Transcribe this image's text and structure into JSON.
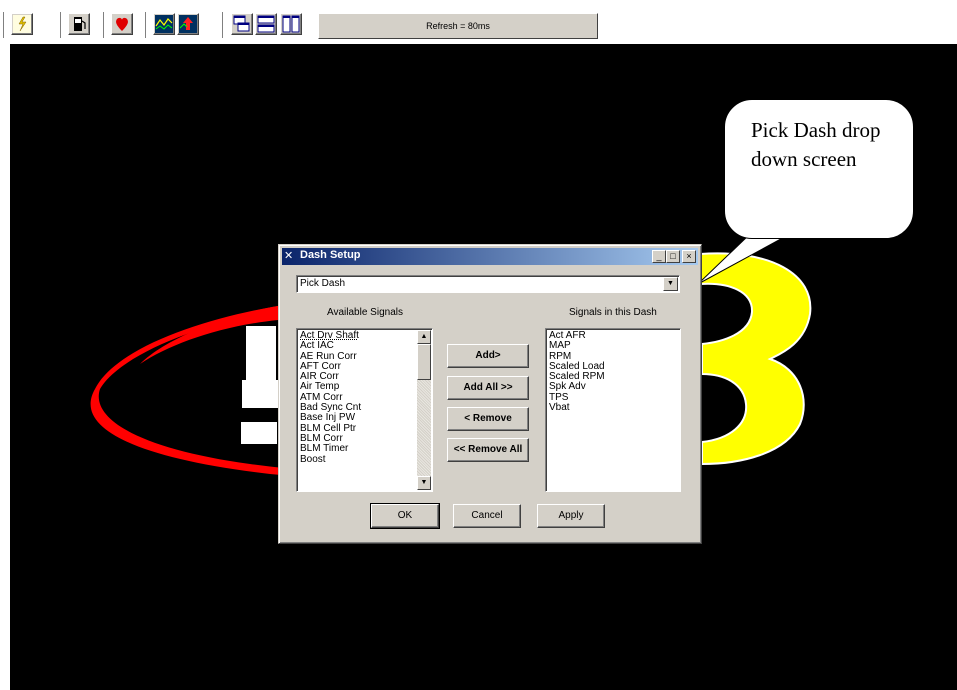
{
  "toolbar": {
    "refresh_label": "Refresh = 80ms",
    "buttons": [
      "lightning-icon",
      "fuel-pump-icon",
      "red-marker-icon",
      "chart-icon",
      "record-arrow-icon",
      "cascade-windows-icon",
      "tile-horizontal-icon",
      "tile-vertical-icon"
    ]
  },
  "callout": {
    "text": "Pick Dash drop down screen"
  },
  "dialog": {
    "title": "Dash Setup",
    "caption_buttons": {
      "minimize": "_",
      "maximize": "□",
      "close": "×"
    },
    "combo": {
      "value": "Pick Dash",
      "arrow": "▼"
    },
    "available_label": "Available Signals",
    "dash_label": "Signals in this Dash",
    "available_signals": [
      "Act Drv Shaft",
      "Act IAC",
      "AE Run Corr",
      "AFT Corr",
      "AIR Corr",
      "Air Temp",
      "ATM Corr",
      "Bad Sync Cnt",
      "Base Inj PW",
      "BLM Cell Ptr",
      "BLM Corr",
      "BLM Timer",
      "Boost"
    ],
    "dash_signals": [
      "Act AFR",
      "MAP",
      "RPM",
      "Scaled Load",
      "Scaled RPM",
      "Spk Adv",
      "TPS",
      "Vbat"
    ],
    "scroll_up": "▲",
    "scroll_down": "▼",
    "buttons": {
      "add": "Add>",
      "add_all": "Add All >>",
      "remove": "< Remove",
      "remove_all": "<< Remove All",
      "ok": "OK",
      "cancel": "Cancel",
      "apply": "Apply"
    }
  },
  "colors": {
    "background": "#000000",
    "dialog_face": "#d4d0c8",
    "title_start": "#0a246a",
    "title_end": "#a6caf0",
    "logo_red": "#ff0000",
    "logo_yellow": "#ffff00"
  }
}
